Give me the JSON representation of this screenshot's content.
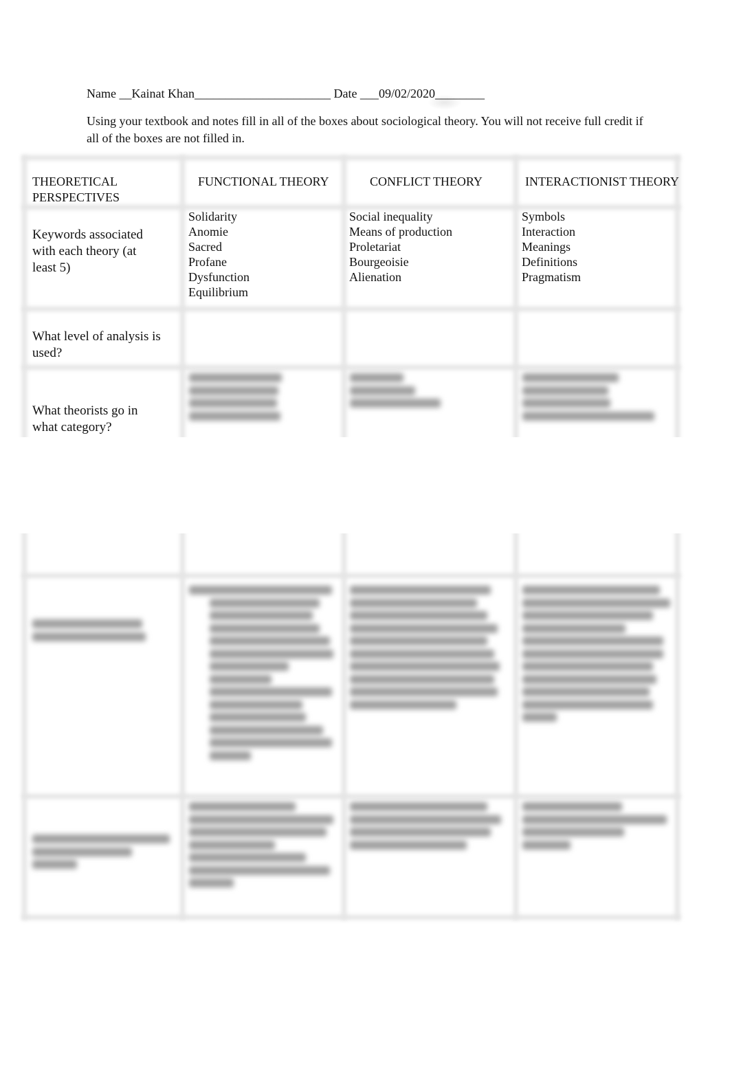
{
  "header": {
    "name_label": "Name __",
    "name_value": "Kainat Khan",
    "name_trailing": "______________________",
    "date_label": " Date ___",
    "date_value": "09/02/2020",
    "date_trailing": "________"
  },
  "instructions": "Using your textbook and notes fill in all of the boxes about sociological theory.  You will not receive full credit if all of the boxes are not filled in.",
  "table": {
    "columns": [
      "THEORETICAL PERSPECTIVES",
      "FUNCTIONAL THEORY",
      "CONFLICT THEORY",
      "INTERACTIONIST THEORY"
    ],
    "rows": [
      {
        "label": "Keywords associated with each theory (at least 5)",
        "functional": [
          "Solidarity",
          "Anomie",
          "Sacred",
          "Profane",
          "Dysfunction",
          "Equilibrium"
        ],
        "conflict": [
          "Social inequality",
          "Means of production",
          "Proletariat",
          "Bourgeoisie",
          "Alienation"
        ],
        "interactionist": [
          "Symbols",
          "Interaction",
          "Meanings",
          "Definitions",
          "Pragmatism"
        ]
      },
      {
        "label": "What level of analysis is used?",
        "functional": [],
        "conflict": [],
        "interactionist": []
      },
      {
        "label": "What theorists go in what category?",
        "functional": "[blurred]",
        "conflict": "[blurred]",
        "interactionist": "[blurred]"
      },
      {
        "label": "[blurred]",
        "functional": "[blurred]",
        "conflict": "[blurred]",
        "interactionist": "[blurred]"
      },
      {
        "label": "[blurred]",
        "functional": "[blurred]",
        "conflict": "[blurred]",
        "interactionist": "[blurred]"
      }
    ]
  },
  "colors": {
    "text": "#111111",
    "border": "#e4e4e4",
    "blurred_text": "#8a8a8a"
  }
}
